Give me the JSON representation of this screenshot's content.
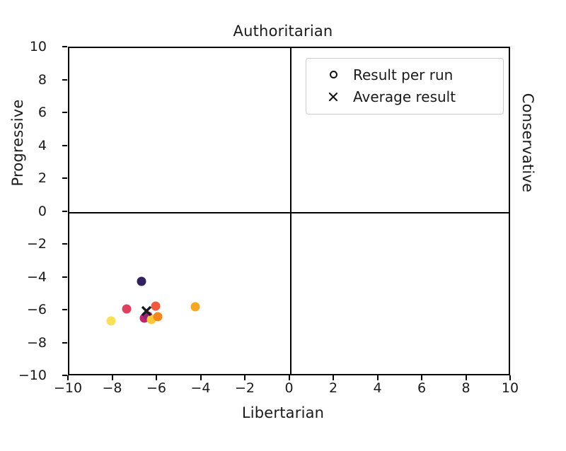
{
  "chart_data": {
    "type": "scatter",
    "title": "",
    "top_label": "Authoritarian",
    "bottom_label": "Libertarian",
    "left_label": "Progressive",
    "right_label": "Conservative",
    "xlabel": "Libertarian",
    "ylabel": "Progressive",
    "xlim": [
      -10,
      10
    ],
    "ylim": [
      -10,
      10
    ],
    "xticks": [
      "−10",
      "−8",
      "−6",
      "−4",
      "−2",
      "0",
      "2",
      "4",
      "6",
      "8",
      "10"
    ],
    "xtick_values": [
      -10,
      -8,
      -6,
      -4,
      -2,
      0,
      2,
      4,
      6,
      8,
      10
    ],
    "yticks": [
      "10",
      "8",
      "6",
      "4",
      "2",
      "0",
      "−2",
      "−4",
      "−6",
      "−8",
      "−10"
    ],
    "ytick_values": [
      10,
      8,
      6,
      4,
      2,
      0,
      -2,
      -4,
      -6,
      -8,
      -10
    ],
    "grid": false,
    "quadrant_lines": {
      "x": 0,
      "y": 0
    },
    "legend": {
      "position": "upper right",
      "entries": [
        {
          "marker": "circle-open",
          "label": "Result per run"
        },
        {
          "marker": "x-cross",
          "label": "Average result"
        }
      ]
    },
    "series": [
      {
        "name": "Result per run",
        "marker": "circle",
        "points": [
          {
            "x": -6.75,
            "y": -4.2,
            "color": "#31215e"
          },
          {
            "x": -7.4,
            "y": -5.85,
            "color": "#e0405e"
          },
          {
            "x": -8.1,
            "y": -6.6,
            "color": "#f7e05a"
          },
          {
            "x": -6.1,
            "y": -5.7,
            "color": "#f05a40"
          },
          {
            "x": -4.3,
            "y": -5.75,
            "color": "#f5a623"
          },
          {
            "x": -6.6,
            "y": -6.45,
            "color": "#c2216b"
          },
          {
            "x": -6.45,
            "y": -6.3,
            "color": "#99217a"
          },
          {
            "x": -6.3,
            "y": -6.5,
            "color": "#f7c83c"
          },
          {
            "x": -6.0,
            "y": -6.35,
            "color": "#f4881f"
          }
        ]
      },
      {
        "name": "Average result",
        "marker": "x",
        "points": [
          {
            "x": -6.5,
            "y": -6.0,
            "color": "#1a1a1a"
          }
        ]
      }
    ]
  }
}
